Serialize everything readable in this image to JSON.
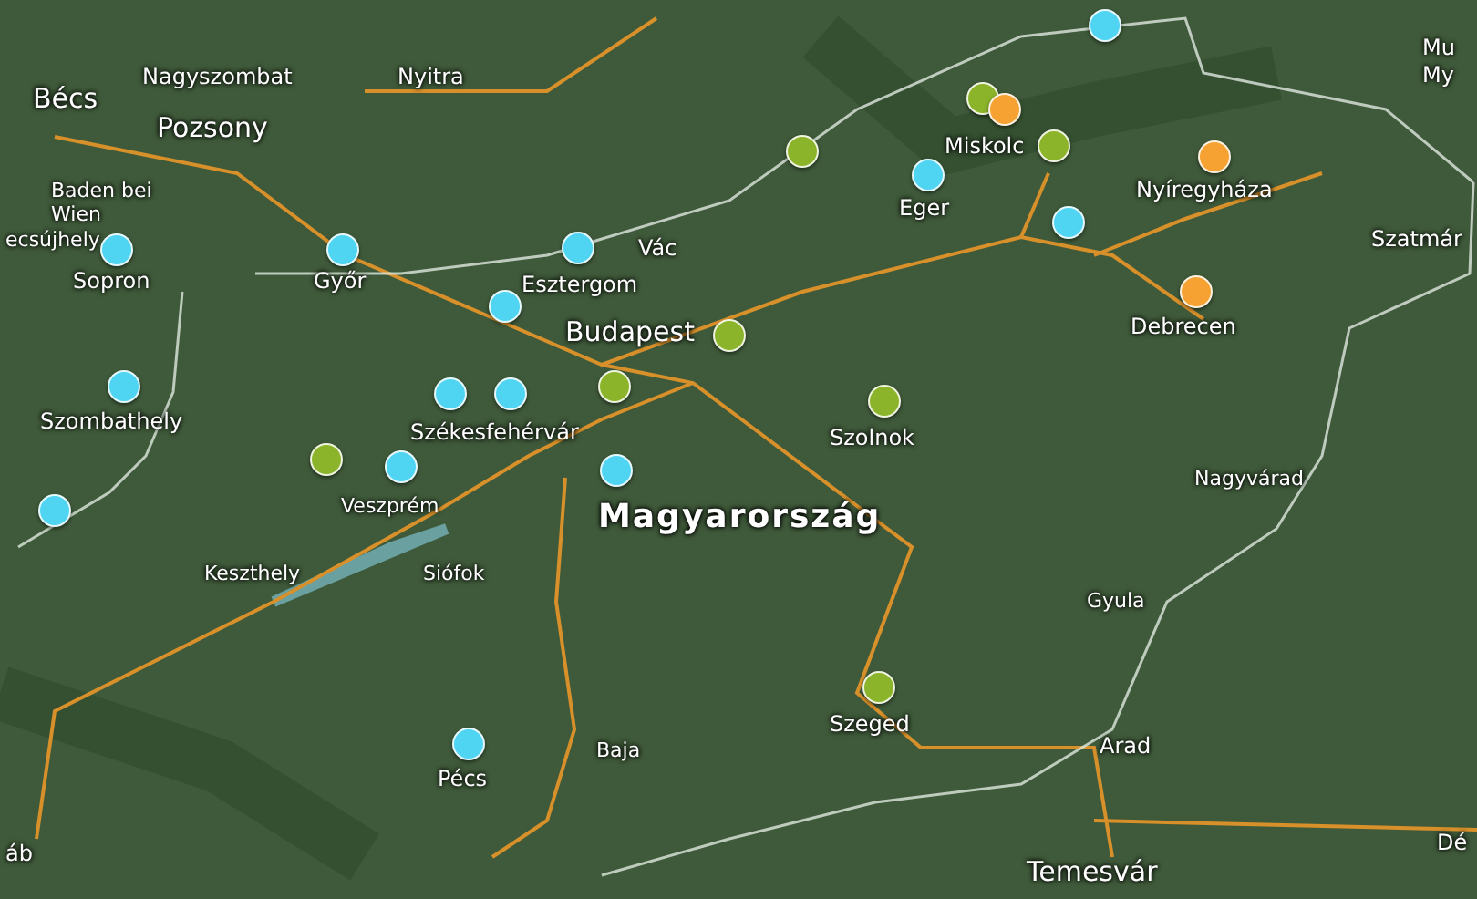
{
  "map": {
    "labels": [
      {
        "text": "Nagyszombat",
        "kind": "town"
      },
      {
        "text": "Nyitra",
        "kind": "town"
      },
      {
        "text": "Bécs",
        "kind": "city"
      },
      {
        "text": "Pozsony",
        "kind": "city"
      },
      {
        "text": "Baden bei Wien",
        "kind": "small"
      },
      {
        "text": "ecsújhely",
        "kind": "small"
      },
      {
        "text": "Sopron",
        "kind": "town"
      },
      {
        "text": "Győr",
        "kind": "town"
      },
      {
        "text": "Esztergom",
        "kind": "town"
      },
      {
        "text": "Vác",
        "kind": "town"
      },
      {
        "text": "Budapest",
        "kind": "city"
      },
      {
        "text": "Szombathely",
        "kind": "town"
      },
      {
        "text": "Székesfehérvár",
        "kind": "town"
      },
      {
        "text": "Veszprém",
        "kind": "small"
      },
      {
        "text": "Keszthely",
        "kind": "small"
      },
      {
        "text": "Siófok",
        "kind": "small"
      },
      {
        "text": "Magyarország",
        "kind": "country"
      },
      {
        "text": "Szolnok",
        "kind": "town"
      },
      {
        "text": "Miskolc",
        "kind": "town"
      },
      {
        "text": "Eger",
        "kind": "town"
      },
      {
        "text": "Nyíregyháza",
        "kind": "town"
      },
      {
        "text": "Debrecen",
        "kind": "town"
      },
      {
        "text": "Mu",
        "kind": "town"
      },
      {
        "text": "My",
        "kind": "town"
      },
      {
        "text": "Szatmár",
        "kind": "town"
      },
      {
        "text": "Nagyvárad",
        "kind": "small"
      },
      {
        "text": "Gyula",
        "kind": "small"
      },
      {
        "text": "Arad",
        "kind": "town"
      },
      {
        "text": "Szeged",
        "kind": "town"
      },
      {
        "text": "Baja",
        "kind": "small"
      },
      {
        "text": "Pécs",
        "kind": "town"
      },
      {
        "text": "Temesvár",
        "kind": "city"
      },
      {
        "text": "áb",
        "kind": "town"
      },
      {
        "text": "Dé",
        "kind": "town"
      }
    ],
    "pins": [
      {
        "color": "#4fd4f2"
      },
      {
        "color": "#4fd4f2"
      },
      {
        "color": "#4fd4f2"
      },
      {
        "color": "#4fd4f2"
      },
      {
        "color": "#4fd4f2"
      },
      {
        "color": "#4fd4f2"
      },
      {
        "color": "#4fd4f2"
      },
      {
        "color": "#4fd4f2"
      },
      {
        "color": "#4fd4f2"
      },
      {
        "color": "#4fd4f2"
      },
      {
        "color": "#4fd4f2"
      },
      {
        "color": "#4fd4f2"
      },
      {
        "color": "#4fd4f2"
      },
      {
        "color": "#4fd4f2"
      },
      {
        "color": "#8cb42a"
      },
      {
        "color": "#8cb42a"
      },
      {
        "color": "#8cb42a"
      },
      {
        "color": "#8cb42a"
      },
      {
        "color": "#8cb42a"
      },
      {
        "color": "#8cb42a"
      },
      {
        "color": "#8cb42a"
      },
      {
        "color": "#8cb42a"
      },
      {
        "color": "#f5a232"
      },
      {
        "color": "#f5a232"
      },
      {
        "color": "#f5a232"
      }
    ]
  }
}
